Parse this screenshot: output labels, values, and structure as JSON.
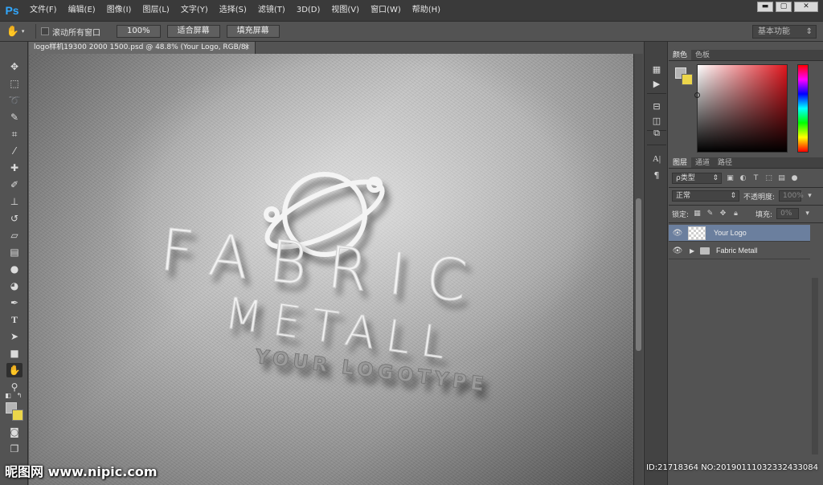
{
  "app": {
    "logo": "Ps"
  },
  "menu": [
    "文件(F)",
    "编辑(E)",
    "图像(I)",
    "图层(L)",
    "文字(Y)",
    "选择(S)",
    "滤镜(T)",
    "3D(D)",
    "视图(V)",
    "窗口(W)",
    "帮助(H)"
  ],
  "window_controls": {
    "minimize": "▬",
    "restore": "▢",
    "close": "✕"
  },
  "options_bar": {
    "scroll_all_label": "滚动所有窗口",
    "zoom_100": "100%",
    "fit_screen": "适合屏幕",
    "fill_screen": "填充屏幕",
    "workspace": "基本功能"
  },
  "document": {
    "tab_title": "logo样机19300 2000 1500.psd @ 48.8% (Your Logo, RGB/8)",
    "close": "×"
  },
  "canvas_art": {
    "line1": "FABRIC",
    "line2": "METALL",
    "line3": "YOUR LOGOTYPE",
    "text_color": "#f2f2f2"
  },
  "color_panel": {
    "tabs": [
      "颜色",
      "色板"
    ],
    "foreground": "#b5b5b5",
    "background": "#ecd64a"
  },
  "layers_panel": {
    "tabs": [
      "图层",
      "通道",
      "路径"
    ],
    "filter_kind": "ρ类型",
    "blend_mode": "正常",
    "opacity_label": "不透明度:",
    "opacity_value": "100%",
    "lock_label": "锁定:",
    "fill_label": "填充:",
    "fill_value": "0%",
    "layers": [
      {
        "name": "Your Logo",
        "selected": true
      },
      {
        "name": "Fabric Metall",
        "selected": false
      }
    ]
  },
  "watermark": {
    "left": "昵图网 www.nipic.com",
    "right": "ID:21718364 NO:20190111032332433084"
  }
}
